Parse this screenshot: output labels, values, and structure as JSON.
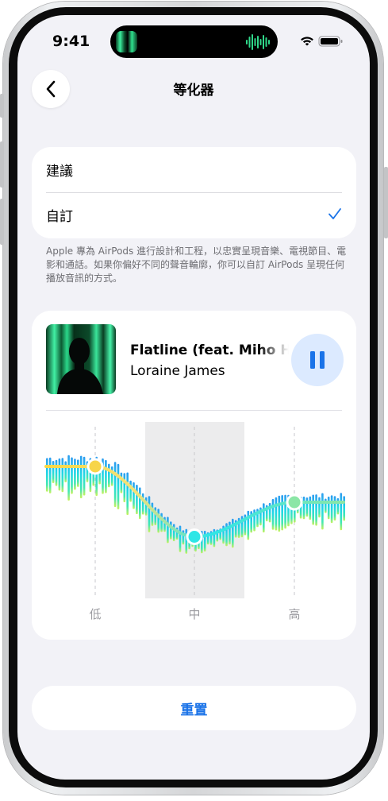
{
  "status": {
    "time": "9:41"
  },
  "nav": {
    "title": "等化器",
    "back_icon": "chevron-left-icon"
  },
  "mode": {
    "options": [
      {
        "label": "建議",
        "selected": false
      },
      {
        "label": "自訂",
        "selected": true
      }
    ]
  },
  "footnote": "Apple 專為 AirPods 進行設計和工程，以忠實呈現音樂、電視節目、電影和通話。如果你偏好不同的聲音輪廓，你可以自訂 AirPods 呈現任何播放音訊的方式。",
  "player": {
    "track_title": "Flatline (feat. Miho Hazama)",
    "artist": "Loraine James",
    "control_icon": "pause-icon"
  },
  "equalizer": {
    "bands": [
      {
        "label": "低",
        "level": 0.84,
        "color": "#f7d54a"
      },
      {
        "label": "中",
        "level": 0.25,
        "color": "#2ee6e6"
      },
      {
        "label": "高",
        "level": 0.54,
        "color": "#8ce6a6"
      }
    ],
    "selected_band": "中"
  },
  "reset": {
    "label": "重置"
  },
  "colors": {
    "accent": "#1a73e8",
    "pause_bg": "#dceaff",
    "screen_bg": "#f2f2f7"
  }
}
